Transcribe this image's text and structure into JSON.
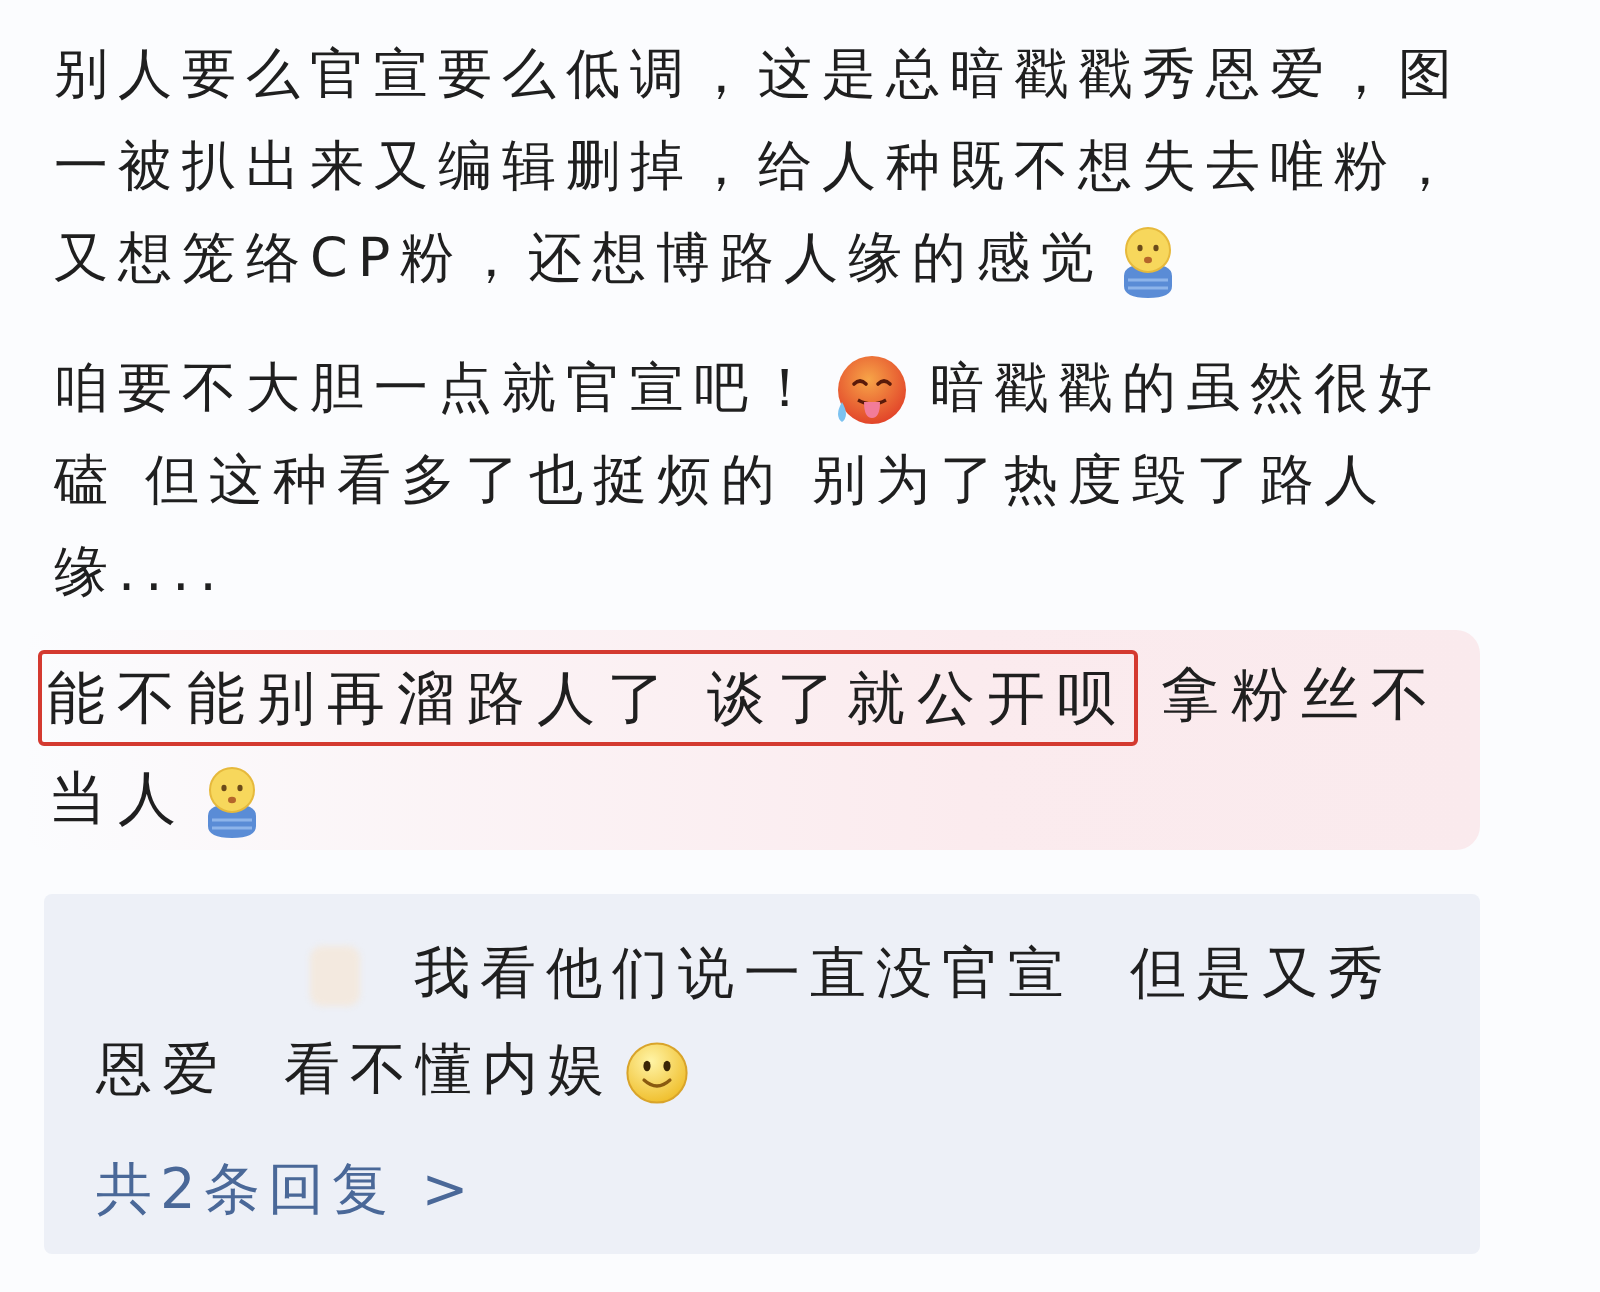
{
  "comments": [
    {
      "kind": "plain",
      "lines": [
        [
          {
            "kind": "text",
            "text": "别人要么官宣要么低调，这是总暗戳戳秀恩爱，图"
          }
        ],
        [
          {
            "kind": "text",
            "text": "一被扒出来又编辑删掉，给人种既不想失去唯粉，"
          }
        ],
        [
          {
            "kind": "text",
            "text": "又想笼络CP粉，还想博路人缘的感觉"
          },
          {
            "kind": "scarf_face_emoji"
          }
        ]
      ]
    },
    {
      "kind": "plain",
      "lines": [
        [
          {
            "kind": "text",
            "text": "咱要不大胆一点就官宣吧！"
          },
          {
            "kind": "hot_face_emoji"
          },
          {
            "kind": "text",
            "text": "暗戳戳的虽然很好"
          }
        ],
        [
          {
            "kind": "text",
            "text": "磕 但这种看多了也挺烦的 别为了热度毁了路人"
          }
        ],
        [
          {
            "kind": "text",
            "text": "缘...."
          }
        ]
      ]
    },
    {
      "kind": "highlighted",
      "lines": [
        [
          {
            "kind": "boxed_text",
            "text": "能不能别再溜路人了 谈了就公开呗"
          },
          {
            "kind": "text",
            "text": "拿粉丝不"
          }
        ],
        [
          {
            "kind": "text",
            "text": "当人"
          },
          {
            "kind": "scarf_face_emoji"
          }
        ]
      ]
    }
  ],
  "reply_box": {
    "lines": [
      [
        {
          "kind": "blurred_name"
        },
        {
          "kind": "text",
          "text": "我看他们说一直没官宣  但是又秀"
        }
      ],
      [
        {
          "kind": "text",
          "text": "恩爱  看不懂内娱"
        },
        {
          "kind": "smile_emoji"
        }
      ]
    ],
    "more_replies": "共2条回复 >"
  }
}
